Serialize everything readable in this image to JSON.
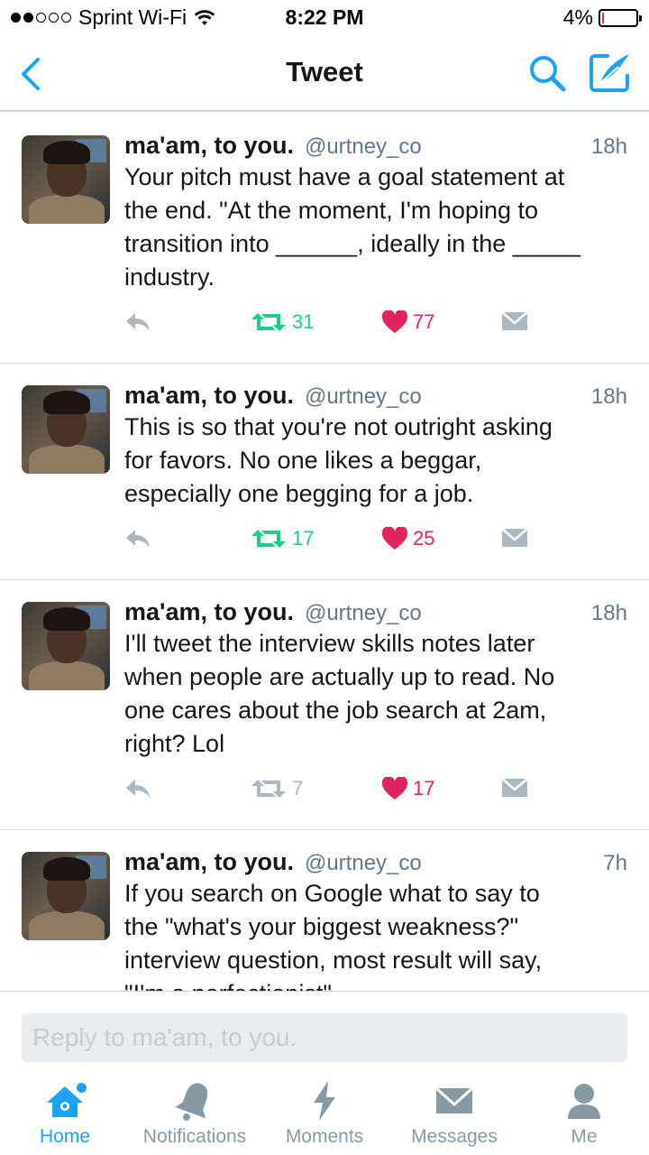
{
  "status_bar": {
    "carrier": "Sprint Wi-Fi",
    "time": "8:22 PM",
    "battery_percent": "4%",
    "battery_level": 0.04,
    "signal_bars_filled": 2,
    "signal_bars_total": 5
  },
  "nav": {
    "title": "Tweet",
    "back_icon": "chevron-left-icon",
    "search_icon": "search-icon",
    "compose_icon": "compose-icon"
  },
  "tweets": [
    {
      "name": "ma'am, to you.",
      "handle": "@urtney_co",
      "time": "18h",
      "text": "Your pitch must have a goal statement at\nthe end. \"At the moment, I'm hoping to\ntransition into ______, ideally in the _____\nindustry.",
      "retweets": "31",
      "likes": "77",
      "retweeted": true
    },
    {
      "name": "ma'am, to you.",
      "handle": "@urtney_co",
      "time": "18h",
      "text": "This is so that you're not outright asking\nfor favors. No one likes a beggar,\nespecially one begging for a job.",
      "retweets": "17",
      "likes": "25",
      "retweeted": true
    },
    {
      "name": "ma'am, to you.",
      "handle": "@urtney_co",
      "time": "18h",
      "text": "I'll tweet the interview skills notes later\nwhen people are actually up to read. No\none cares about the job search at 2am,\nright? Lol",
      "retweets": "7",
      "likes": "17",
      "retweeted": false
    },
    {
      "name": "ma'am, to you.",
      "handle": "@urtney_co",
      "time": "7h",
      "text": "If you search on Google what to say to\nthe \"what's your biggest weakness?\"\ninterview question, most result will say,\n\"I'm a perfectionist\"",
      "retweets": "",
      "likes": "",
      "retweeted": false
    }
  ],
  "reply": {
    "placeholder": "Reply to ma'am, to you."
  },
  "tabs": [
    {
      "label": "Home",
      "icon": "home-icon",
      "active": true
    },
    {
      "label": "Notifications",
      "icon": "bell-icon",
      "active": false
    },
    {
      "label": "Moments",
      "icon": "lightning-icon",
      "active": false
    },
    {
      "label": "Messages",
      "icon": "envelope-icon",
      "active": false
    },
    {
      "label": "Me",
      "icon": "person-icon",
      "active": false
    }
  ],
  "colors": {
    "accent": "#1da1f2",
    "retweet": "#19cf86",
    "like": "#e0245e",
    "muted": "#8899a6"
  }
}
